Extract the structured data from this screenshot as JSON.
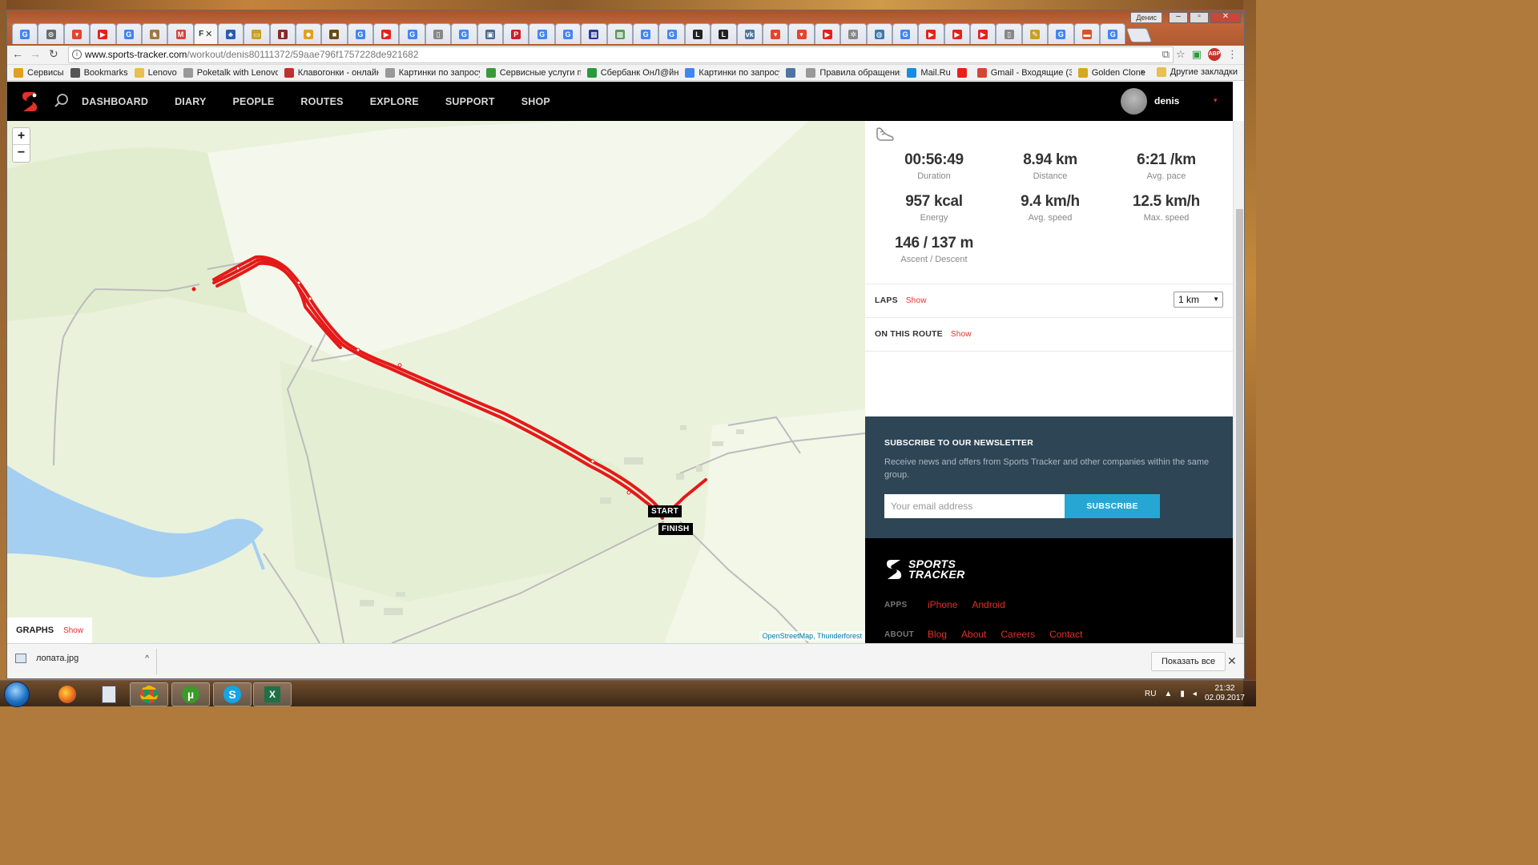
{
  "browser": {
    "tabs": [
      {
        "icon": "google-icon",
        "color": "#4285f4",
        "glyph": "G"
      },
      {
        "icon": "tab-icon",
        "color": "#6a6a6a",
        "glyph": "⊙"
      },
      {
        "icon": "pocket-icon",
        "color": "#e4442a",
        "glyph": "▾"
      },
      {
        "icon": "youtube-icon",
        "color": "#e62117",
        "glyph": "▶"
      },
      {
        "icon": "google-icon",
        "color": "#4285f4",
        "glyph": "G"
      },
      {
        "icon": "tab-icon",
        "color": "#a07840",
        "glyph": "♞"
      },
      {
        "icon": "gmail-icon",
        "color": "#d44638",
        "glyph": "M"
      },
      {
        "icon": "tree-icon",
        "color": "#2a5db0",
        "glyph": "♣"
      },
      {
        "icon": "tab-icon",
        "color": "#c9a020",
        "glyph": "▭"
      },
      {
        "icon": "tab-icon",
        "color": "#8a2a2a",
        "glyph": "▮"
      },
      {
        "icon": "tab-icon",
        "color": "#e0a020",
        "glyph": "☻"
      },
      {
        "icon": "tab-icon",
        "color": "#6a4a10",
        "glyph": "■"
      },
      {
        "icon": "google-icon",
        "color": "#4285f4",
        "glyph": "G"
      },
      {
        "icon": "youtube-icon",
        "color": "#e62117",
        "glyph": "▶"
      },
      {
        "icon": "google-icon",
        "color": "#4285f4",
        "glyph": "G"
      },
      {
        "icon": "doc-icon",
        "color": "#888888",
        "glyph": "▯"
      },
      {
        "icon": "google-icon",
        "color": "#4285f4",
        "glyph": "G"
      },
      {
        "icon": "tab-icon",
        "color": "#4a6a90",
        "glyph": "▣"
      },
      {
        "icon": "pinterest-icon",
        "color": "#cb2027",
        "glyph": "P"
      },
      {
        "icon": "google-icon",
        "color": "#4285f4",
        "glyph": "G"
      },
      {
        "icon": "google-icon",
        "color": "#4285f4",
        "glyph": "G"
      },
      {
        "icon": "tab-icon",
        "color": "#2a3a9a",
        "glyph": "▦"
      },
      {
        "icon": "tab-icon",
        "color": "#5a9a5a",
        "glyph": "▩"
      },
      {
        "icon": "google-icon",
        "color": "#4285f4",
        "glyph": "G"
      },
      {
        "icon": "google-icon",
        "color": "#4285f4",
        "glyph": "G"
      },
      {
        "icon": "tab-icon",
        "color": "#222222",
        "glyph": "L"
      },
      {
        "icon": "tab-icon",
        "color": "#222222",
        "glyph": "L"
      },
      {
        "icon": "vk-icon",
        "color": "#4c75a3",
        "glyph": "vk"
      },
      {
        "icon": "pocket-icon",
        "color": "#e4442a",
        "glyph": "▾"
      },
      {
        "icon": "pocket-icon",
        "color": "#e4442a",
        "glyph": "▾"
      },
      {
        "icon": "youtube-icon",
        "color": "#e62117",
        "glyph": "▶"
      },
      {
        "icon": "gear-icon",
        "color": "#888888",
        "glyph": "✲"
      },
      {
        "icon": "tab-icon",
        "color": "#3a7ab0",
        "glyph": "◍"
      },
      {
        "icon": "google-icon",
        "color": "#4285f4",
        "glyph": "G"
      },
      {
        "icon": "youtube-icon",
        "color": "#e62117",
        "glyph": "▶"
      },
      {
        "icon": "youtube-icon",
        "color": "#e62117",
        "glyph": "▶"
      },
      {
        "icon": "youtube-icon",
        "color": "#e62117",
        "glyph": "▶"
      },
      {
        "icon": "doc-icon",
        "color": "#888888",
        "glyph": "▯"
      },
      {
        "icon": "tab-icon",
        "color": "#c8a020",
        "glyph": "✎"
      },
      {
        "icon": "google-icon",
        "color": "#4285f4",
        "glyph": "G"
      },
      {
        "icon": "tab-icon",
        "color": "#e05020",
        "glyph": "▬"
      },
      {
        "icon": "google-icon",
        "color": "#4285f4",
        "glyph": "G"
      }
    ],
    "active_tab_glyph": "F",
    "active_tab_close": "✕",
    "window_user": "Денис",
    "url_host": "www.sports-tracker.com",
    "url_path": "/workout/denis80111372/59aae796f1757228de921682",
    "bookmarks": [
      {
        "label": "Сервисы",
        "icon": "apps-icon",
        "color": "#e0a020"
      },
      {
        "label": "Bookmarks",
        "icon": "star-icon",
        "color": "#555555"
      },
      {
        "label": "Lenovo",
        "icon": "folder-icon",
        "color": "#e8c050"
      },
      {
        "label": "Poketalk with Lenovo",
        "icon": "doc-icon",
        "color": "#999999"
      },
      {
        "label": "Клавогонки - онлайн",
        "icon": "car-icon",
        "color": "#c03030"
      },
      {
        "label": "Картинки по запросу",
        "icon": "doc-icon",
        "color": "#999999"
      },
      {
        "label": "Сервисные услуги п",
        "icon": "leaf-icon",
        "color": "#3a9a3a"
      },
      {
        "label": "Сбербанк ОнЛ@йн",
        "icon": "sber-icon",
        "color": "#2a9a3a"
      },
      {
        "label": "Картинки по запросу",
        "icon": "google-icon",
        "color": "#4285f4"
      },
      {
        "label": "",
        "icon": "vk-icon",
        "color": "#4c75a3"
      },
      {
        "label": "Правила обращения",
        "icon": "doc-icon",
        "color": "#999999"
      },
      {
        "label": "Mail.Ru",
        "icon": "mailru-icon",
        "color": "#168de2"
      },
      {
        "label": "",
        "icon": "youtube-icon",
        "color": "#e62117"
      },
      {
        "label": "Gmail - Входящие (3",
        "icon": "gmail-icon",
        "color": "#d44638"
      },
      {
        "label": "Golden Clone",
        "icon": "clone-icon",
        "color": "#d4a820"
      }
    ],
    "bookmarks_more": "»",
    "other_bookmarks": "Другие закладки"
  },
  "site": {
    "nav": [
      "DASHBOARD",
      "DIARY",
      "PEOPLE",
      "ROUTES",
      "EXPLORE",
      "SUPPORT",
      "SHOP"
    ],
    "user_name": "denis",
    "caret": "▾",
    "accent": "#e0312a"
  },
  "map": {
    "zoom_in": "+",
    "zoom_out": "−",
    "start_label": "START",
    "finish_label": "FINISH",
    "graphs_label": "GRAPHS",
    "graphs_show": "Show",
    "attribution": "OpenStreetMap, Thunderforest"
  },
  "workout": {
    "stats": [
      {
        "value": "00:56:49",
        "label": "Duration"
      },
      {
        "value": "8.94 km",
        "label": "Distance"
      },
      {
        "value": "6:21 /km",
        "label": "Avg. pace"
      },
      {
        "value": "957 kcal",
        "label": "Energy"
      },
      {
        "value": "9.4 km/h",
        "label": "Avg. speed"
      },
      {
        "value": "12.5 km/h",
        "label": "Max. speed"
      },
      {
        "value": "146 / 137 m",
        "label": "Ascent / Descent"
      }
    ],
    "laps_label": "LAPS",
    "laps_show": "Show",
    "laps_interval": "1 km",
    "route_label": "ON THIS ROUTE",
    "route_show": "Show"
  },
  "newsletter": {
    "heading": "SUBSCRIBE TO OUR NEWSLETTER",
    "text": "Receive news and offers from Sports Tracker and other companies within the same group.",
    "placeholder": "Your email address",
    "button": "SUBSCRIBE"
  },
  "footer": {
    "brand_line1": "SPORTS",
    "brand_line2": "TRACKER",
    "apps_label": "APPS",
    "apps": [
      "iPhone",
      "Android"
    ],
    "about_label": "ABOUT",
    "about": [
      "Blog",
      "About",
      "Careers",
      "Contact"
    ]
  },
  "downloads": {
    "file": "лопата.jpg",
    "chevron": "^",
    "show_all": "Показать все",
    "close": "✕"
  },
  "taskbar": {
    "lang": "RU",
    "time": "21:32",
    "date": "02.09.2017"
  }
}
